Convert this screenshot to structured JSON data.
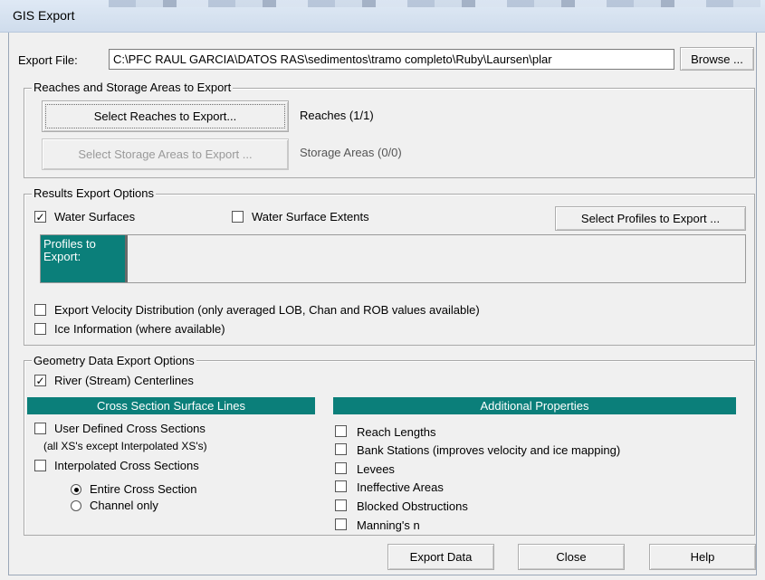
{
  "window": {
    "title": "GIS Export"
  },
  "export_file": {
    "label": "Export File:",
    "value": "C:\\PFC RAUL GARCIA\\DATOS RAS\\sedimentos\\tramo completo\\Ruby\\Laursen\\plar",
    "browse_label": "Browse ..."
  },
  "reaches": {
    "legend": "Reaches and Storage Areas to Export",
    "select_reaches_label": "Select Reaches to Export...",
    "reaches_status": "Reaches (1/1)",
    "select_storage_label": "Select Storage Areas to Export ...",
    "storage_status": "Storage Areas (0/0)"
  },
  "results": {
    "legend": "Results Export Options",
    "water_surfaces": {
      "label": "Water Surfaces",
      "checked": true
    },
    "water_surface_extents": {
      "label": "Water Surface Extents",
      "checked": false
    },
    "select_profiles_label": "Select Profiles to Export ...",
    "profiles_label": "Profiles to Export:",
    "velocity": {
      "label": "Export Velocity Distribution (only averaged LOB, Chan and ROB values available)",
      "checked": false
    },
    "ice": {
      "label": "Ice Information (where available)",
      "checked": false
    }
  },
  "geometry": {
    "legend": "Geometry Data Export Options",
    "centerlines": {
      "label": "River (Stream) Centerlines",
      "checked": true
    },
    "cross_section_header": "Cross Section Surface Lines",
    "user_defined": {
      "label": "User Defined Cross Sections",
      "sublabel": "(all XS's except Interpolated XS's)",
      "checked": false
    },
    "interpolated": {
      "label": "Interpolated Cross Sections",
      "checked": false
    },
    "entire_cross_section": {
      "label": "Entire Cross Section",
      "selected": true
    },
    "channel_only": {
      "label": "Channel only",
      "selected": false
    },
    "additional_header": "Additional Properties",
    "additional": [
      {
        "label": "Reach Lengths",
        "checked": false
      },
      {
        "label": "Bank Stations (improves velocity and ice mapping)",
        "checked": false
      },
      {
        "label": "Levees",
        "checked": false
      },
      {
        "label": "Ineffective Areas",
        "checked": false
      },
      {
        "label": "Blocked Obstructions",
        "checked": false
      },
      {
        "label": "Manning's n",
        "checked": false
      }
    ]
  },
  "footer": {
    "export_label": "Export Data",
    "close_label": "Close",
    "help_label": "Help"
  },
  "colors": {
    "teal": "#0b7f7a",
    "dialog_bg": "#f0f0f0"
  }
}
